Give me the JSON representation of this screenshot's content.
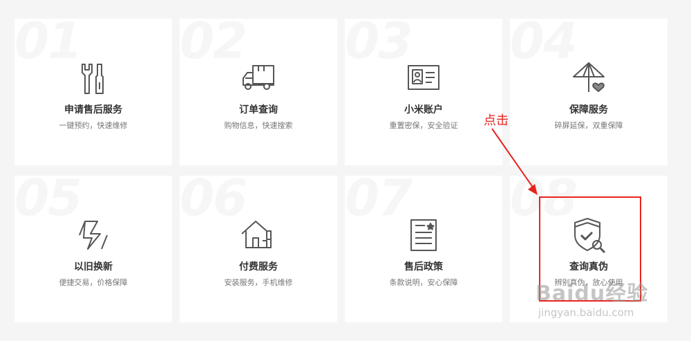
{
  "services": [
    {
      "num": "01",
      "title": "申请售后服务",
      "desc": "一键预约，快速维修",
      "icon": "tools-icon"
    },
    {
      "num": "02",
      "title": "订单查询",
      "desc": "购物信息，快速搜索",
      "icon": "delivery-truck-icon"
    },
    {
      "num": "03",
      "title": "小米账户",
      "desc": "重置密保，安全验证",
      "icon": "id-card-icon"
    },
    {
      "num": "04",
      "title": "保障服务",
      "desc": "碎屏延保，双重保障",
      "icon": "umbrella-heart-icon"
    },
    {
      "num": "05",
      "title": "以旧换新",
      "desc": "便捷交易，价格保障",
      "icon": "exchange-icon"
    },
    {
      "num": "06",
      "title": "付费服务",
      "desc": "安装服务，手机维修",
      "icon": "house-icon"
    },
    {
      "num": "07",
      "title": "售后政策",
      "desc": "条款说明，安心保障",
      "icon": "document-star-icon"
    },
    {
      "num": "08",
      "title": "查询真伪",
      "desc": "辨别真伪，放心使用",
      "icon": "shield-check-search-icon"
    }
  ],
  "annotation": {
    "label": "点击",
    "color": "#e8231e"
  },
  "watermark": {
    "main": "Baidu经验",
    "sub": "jingyan.baidu.com"
  }
}
